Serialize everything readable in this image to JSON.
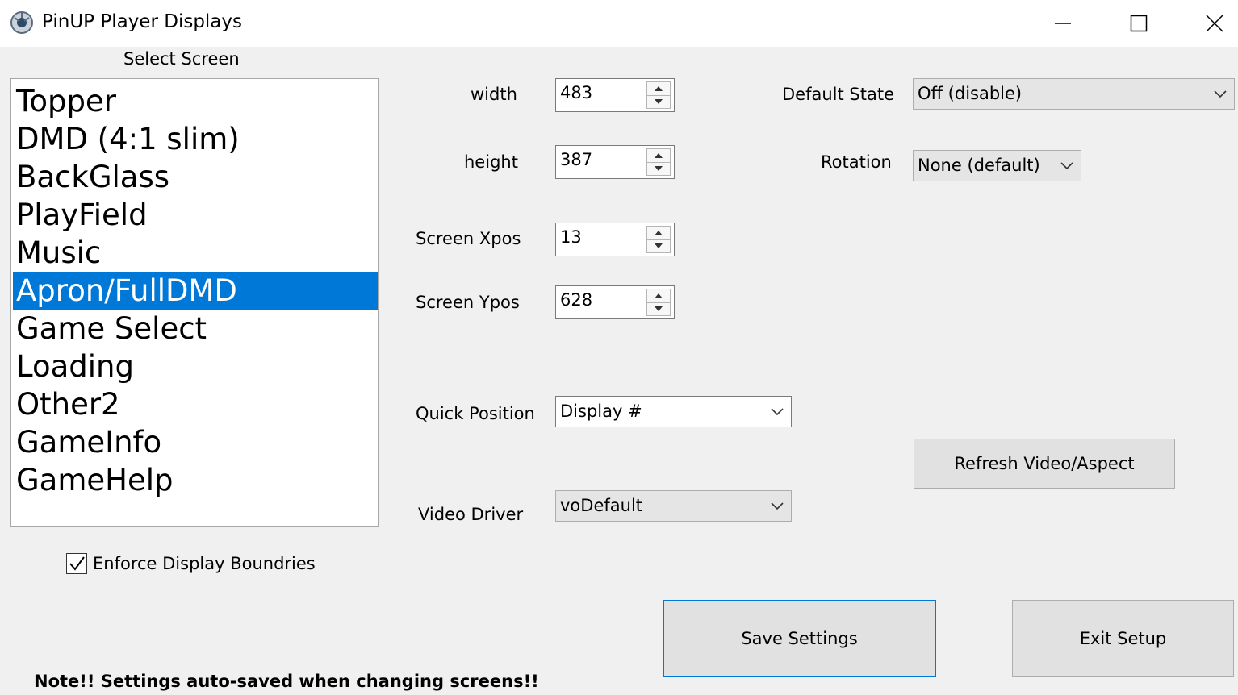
{
  "window": {
    "title": "PinUP Player Displays",
    "icon": "pinup-logo-icon",
    "controls": [
      "minimize-icon",
      "maximize-icon",
      "close-icon"
    ]
  },
  "screen_list": {
    "label": "Select Screen",
    "items": [
      "Topper",
      "DMD (4:1 slim)",
      "BackGlass",
      "PlayField",
      "Music",
      "Apron/FullDMD",
      "Game Select",
      "Loading",
      "Other2",
      "GameInfo",
      "GameHelp"
    ],
    "selected": "Apron/FullDMD"
  },
  "fields": {
    "width": {
      "label": "width",
      "value": "483"
    },
    "height": {
      "label": "height",
      "value": "387"
    },
    "xpos": {
      "label": "Screen Xpos",
      "value": "13"
    },
    "ypos": {
      "label": "Screen Ypos",
      "value": "628"
    },
    "quick_position": {
      "label": "Quick Position",
      "value": "Display #"
    },
    "video_driver": {
      "label": "Video Driver",
      "value": "voDefault"
    },
    "default_state": {
      "label": "Default State",
      "value": "Off (disable)"
    },
    "rotation": {
      "label": "Rotation",
      "value": "None (default)"
    }
  },
  "enforce": {
    "label": "Enforce Display Boundries",
    "checked": true
  },
  "buttons": {
    "refresh": "Refresh Video/Aspect",
    "save": "Save Settings",
    "exit": "Exit Setup"
  },
  "note": "Note!!  Settings auto-saved when changing screens!!",
  "colors": {
    "accent": "#0078d7",
    "background": "#f0f0f0"
  }
}
